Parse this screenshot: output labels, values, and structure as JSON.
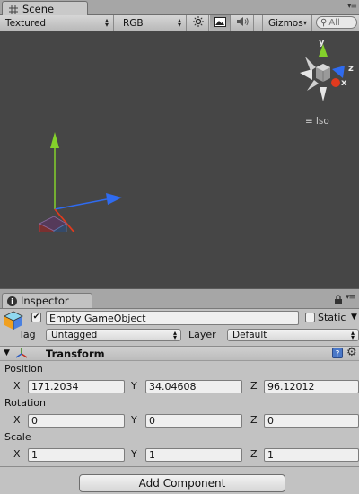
{
  "scene_tab": {
    "title": "Scene"
  },
  "scene_toolbar": {
    "render_mode": "Textured",
    "color_mode": "RGB",
    "gizmos_label": "Gizmos",
    "search_placeholder": "All"
  },
  "scene_view": {
    "projection_label": "Iso",
    "orientation_axes": {
      "y": "y",
      "z": "z",
      "x": "x"
    },
    "colors": {
      "background": "#464646",
      "x_axis": "#e03a1e",
      "y_axis": "#84d12b",
      "z_axis": "#2f6bf0"
    }
  },
  "inspector": {
    "tab_title": "Inspector",
    "object": {
      "active": true,
      "name": "Empty GameObject",
      "static_label": "Static",
      "static": false,
      "tag_label": "Tag",
      "tag_value": "Untagged",
      "layer_label": "Layer",
      "layer_value": "Default"
    },
    "transform": {
      "title": "Transform",
      "position": {
        "label": "Position",
        "x": "171.2034",
        "y": "34.04608",
        "z": "96.12012"
      },
      "rotation": {
        "label": "Rotation",
        "x": "0",
        "y": "0",
        "z": "0"
      },
      "scale": {
        "label": "Scale",
        "x": "1",
        "y": "1",
        "z": "1"
      },
      "axis_labels": {
        "x": "X",
        "y": "Y",
        "z": "Z"
      }
    },
    "add_component_label": "Add Component"
  }
}
